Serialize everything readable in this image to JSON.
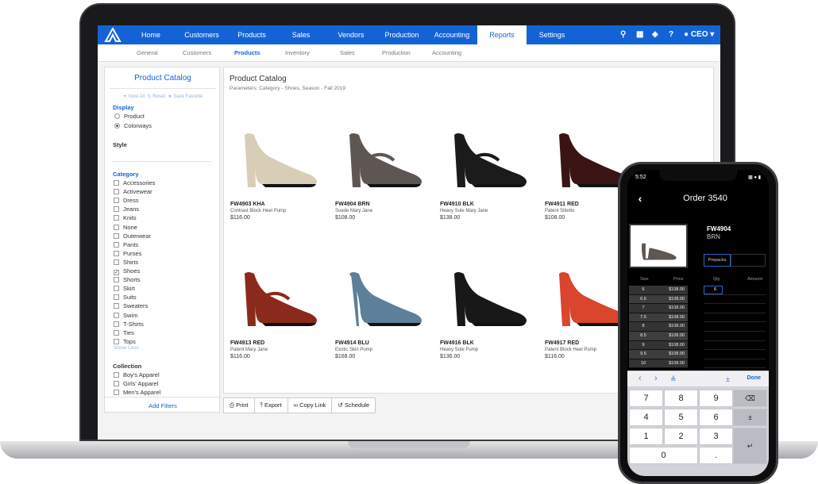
{
  "nav": {
    "items": [
      "Home",
      "Customers",
      "Products",
      "Sales",
      "Vendors",
      "Production",
      "Accounting",
      "Reports",
      "Settings"
    ],
    "active": "Reports",
    "user": "CEO"
  },
  "subnav": {
    "items": [
      "General",
      "Customers",
      "Products",
      "Inventory",
      "Sales",
      "Production",
      "Accounting"
    ],
    "active": "Products"
  },
  "sidebar": {
    "title": "Product Catalog",
    "actions": [
      "View All",
      "Reset",
      "Save Favorite"
    ],
    "display_label": "Display",
    "display_options": [
      "Product",
      "Colorways"
    ],
    "display_selected": "Colorways",
    "style_label": "Style",
    "category_label": "Category",
    "categories": [
      "Accessories",
      "Activewear",
      "Dress",
      "Jeans",
      "Knits",
      "None",
      "Outerwear",
      "Pants",
      "Purses",
      "Shirts",
      "Shoes",
      "Shorts",
      "Skirt",
      "Suits",
      "Sweaters",
      "Swim",
      "T-Shirts",
      "Ties",
      "Tops"
    ],
    "category_checked": "Shoes",
    "show_less": "Show Less",
    "collection_label": "Collection",
    "collections": [
      "Boy's Apparel",
      "Girls' Apparel",
      "Men's Apparel"
    ],
    "add_filters": "Add Filters"
  },
  "main": {
    "title": "Product Catalog",
    "params": "Parameters: Category - Shoes, Season - Fall 2019",
    "products": [
      {
        "sku": "FW4903 KHA",
        "name": "Contrast Block Heel Pump",
        "price": "$116.00",
        "color": "#d8cdb6"
      },
      {
        "sku": "FW4904 BRN",
        "name": "Suede Mary Jane",
        "price": "$108.00",
        "color": "#5e5653"
      },
      {
        "sku": "FW4910 BLK",
        "name": "Heavy Sole Mary Jane",
        "price": "$138.00",
        "color": "#1b1b1b"
      },
      {
        "sku": "FW4911 RED",
        "name": "Patent Stiletto",
        "price": "$108.00",
        "color": "#3a1414"
      },
      {
        "sku": "FW4913 RED",
        "name": "Patent Mary Jane",
        "price": "$116.00",
        "color": "#8a2a1c"
      },
      {
        "sku": "FW4914 BLU",
        "name": "Exotic Skin Pump",
        "price": "$168.00",
        "color": "#5d7f99"
      },
      {
        "sku": "FW4916 BLK",
        "name": "Heavy Sole Pump",
        "price": "$136.00",
        "color": "#181818"
      },
      {
        "sku": "FW4917 RED",
        "name": "Patent Block Heel Pump",
        "price": "$116.00",
        "color": "#d9452d"
      }
    ]
  },
  "toolbar": [
    "Print",
    "Export",
    "Copy Link",
    "Schedule"
  ],
  "phone": {
    "time": "5:52",
    "order_title": "Order 3540",
    "sku": "FW4904",
    "color": "BRN",
    "prepacks": "Prepacks",
    "headers": [
      "Size",
      "Price",
      "Qty",
      "Amount"
    ],
    "sizes": [
      {
        "size": "6",
        "price": "$108.00"
      },
      {
        "size": "6.5",
        "price": "$108.00"
      },
      {
        "size": "7",
        "price": "$108.00"
      },
      {
        "size": "7.5",
        "price": "$108.00"
      },
      {
        "size": "8",
        "price": "$108.00"
      },
      {
        "size": "8.5",
        "price": "$108.00"
      },
      {
        "size": "9",
        "price": "$108.00"
      },
      {
        "size": "9.5",
        "price": "$108.00"
      },
      {
        "size": "10",
        "price": "$108.00"
      }
    ],
    "qty_value": "6",
    "done": "Done",
    "keys": [
      "7",
      "8",
      "9",
      "⌫",
      "4",
      "5",
      "6",
      "±",
      "1",
      "2",
      "3",
      "↵",
      "0",
      "."
    ]
  }
}
